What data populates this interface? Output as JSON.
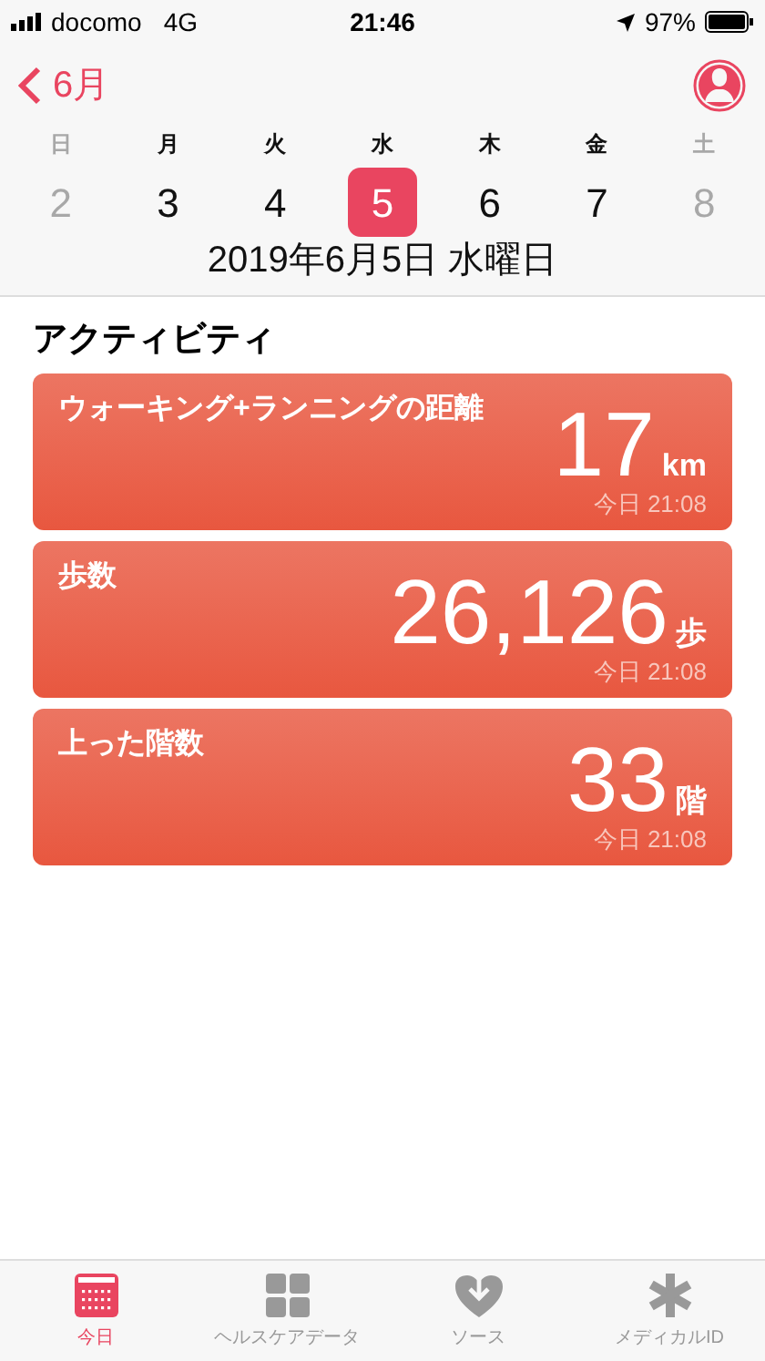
{
  "status_bar": {
    "carrier": "docomo",
    "network": "4G",
    "time": "21:46",
    "battery": "97%"
  },
  "nav": {
    "back_label": "6月"
  },
  "week": [
    {
      "weekday": "日",
      "date": "2",
      "muted": true,
      "selected": false
    },
    {
      "weekday": "月",
      "date": "3",
      "muted": false,
      "selected": false
    },
    {
      "weekday": "火",
      "date": "4",
      "muted": false,
      "selected": false
    },
    {
      "weekday": "水",
      "date": "5",
      "muted": false,
      "selected": true
    },
    {
      "weekday": "木",
      "date": "6",
      "muted": false,
      "selected": false
    },
    {
      "weekday": "金",
      "date": "7",
      "muted": false,
      "selected": false
    },
    {
      "weekday": "土",
      "date": "8",
      "muted": true,
      "selected": false
    }
  ],
  "selected_date": "2019年6月5日 水曜日",
  "section_title": "アクティビティ",
  "cards": [
    {
      "title": "ウォーキング+ランニングの距離",
      "value": "17",
      "unit": "km",
      "time": "今日 21:08"
    },
    {
      "title": "歩数",
      "value": "26,126",
      "unit": "歩",
      "time": "今日 21:08"
    },
    {
      "title": "上った階数",
      "value": "33",
      "unit": "階",
      "time": "今日 21:08"
    }
  ],
  "tab_bar": [
    {
      "label": "今日",
      "selected": true
    },
    {
      "label": "ヘルスケアデータ",
      "selected": false
    },
    {
      "label": "ソース",
      "selected": false
    },
    {
      "label": "メディカルID",
      "selected": false
    }
  ]
}
